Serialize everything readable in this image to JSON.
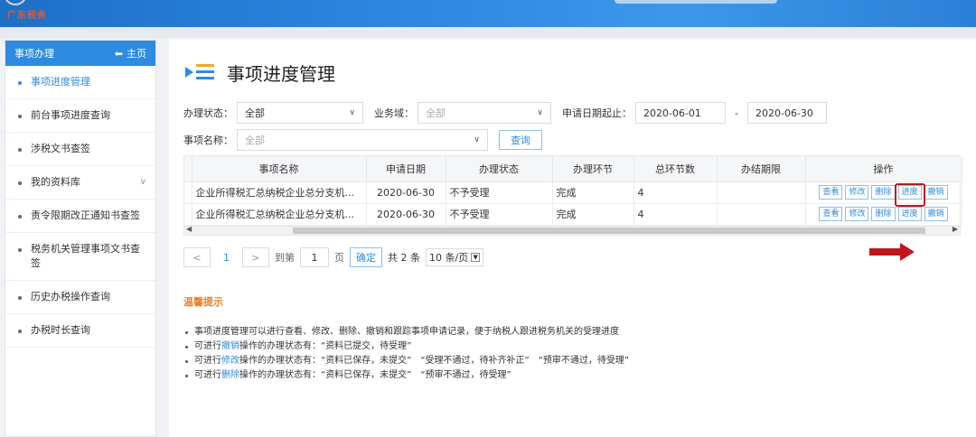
{
  "header": {
    "logo_text": "广东税务"
  },
  "sidebar": {
    "title": "事项办理",
    "home_label": "主页",
    "items": [
      {
        "label": "事项进度管理",
        "active": true
      },
      {
        "label": "前台事项进度查询"
      },
      {
        "label": "涉税文书查签"
      },
      {
        "label": "我的资料库",
        "chevron": "∨"
      },
      {
        "label": "责令限期改正通知书查签"
      },
      {
        "label": "税务机关管理事项文书查签"
      },
      {
        "label": "历史办税操作查询"
      },
      {
        "label": "办税时长查询"
      }
    ]
  },
  "page": {
    "title": "事项进度管理"
  },
  "filters": {
    "status_label": "办理状态：",
    "status_value": "全部",
    "domain_label": "业务域：",
    "domain_value": "全部",
    "date_label": "申请日期起止：",
    "date_from": "2020-06-01",
    "date_sep": "-",
    "date_to": "2020-06-30",
    "name_label": "事项名称：",
    "name_value": "全部",
    "query_label": "查询"
  },
  "table": {
    "headers": [
      "事项名称",
      "申请日期",
      "办理状态",
      "办理环节",
      "总环节数",
      "办结期限",
      "操作"
    ],
    "rows": [
      {
        "name": "企业所得税汇总纳税企业总分支机...",
        "date": "2020-06-30",
        "status": "不予受理",
        "stage": "完成",
        "total": "4",
        "deadline": ""
      },
      {
        "name": "企业所得税汇总纳税企业总分支机...",
        "date": "2020-06-30",
        "status": "不予受理",
        "stage": "完成",
        "total": "4",
        "deadline": ""
      }
    ],
    "ops": [
      "查看",
      "修改",
      "删除",
      "进度",
      "撤销"
    ]
  },
  "pager": {
    "prev": "<",
    "page": "1",
    "next": ">",
    "goto_label": "到第",
    "goto_value": "1",
    "page_unit": "页",
    "ok_label": "确定",
    "total_text": "共 2 条",
    "size_text": "10 条/页"
  },
  "tips": {
    "title": "温馨提示",
    "line1": "事项进度管理可以进行查看、修改、删除、撤销和跟踪事项申请记录，便于纳税人跟进税务机关的受理进度",
    "line2_pre": "可进行",
    "line2_link": "撤销",
    "line2_post": "操作的办理状态有：“资料已提交，待受理”",
    "line3_pre": "可进行",
    "line3_link": "修改",
    "line3_post": "操作的办理状态有：“资料已保存，未提交”　“受理不通过，待补齐补正”　“预审不通过，待受理”",
    "line4_pre": "可进行",
    "line4_link": "删除",
    "line4_post": "操作的办理状态有：“资料已保存，未提交”　“预审不通过，待受理”"
  },
  "colors": {
    "accent": "#2d8ce0",
    "highlight": "#c0161c",
    "tip_title": "#e8812c"
  }
}
